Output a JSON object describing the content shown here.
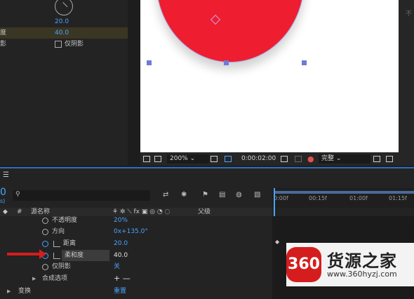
{
  "effect_controls": {
    "rows": [
      {
        "label": "",
        "value": ""
      },
      {
        "label": "",
        "value": "20.0"
      },
      {
        "label": "度",
        "value": "40.0"
      },
      {
        "label": "影",
        "checkbox_label": "仅阴影"
      }
    ]
  },
  "right_panel": {
    "label": "不"
  },
  "viewer": {
    "zoom": "200%",
    "timecode": "0:00:02:00",
    "quality": "完整",
    "colors": {
      "fill": "#ee1d2f",
      "background": "#ffffff"
    }
  },
  "timeline": {
    "comp_time": "0",
    "comp_sub": "s)",
    "columns": {
      "source_name": "源名称",
      "parent": "父级"
    },
    "ruler_ticks": [
      "0:00f",
      "00:15f",
      "01:00f",
      "01:15f"
    ],
    "rows": [
      {
        "name": "不透明度",
        "value": "20%"
      },
      {
        "name": "方向",
        "value": "0x+135.0°"
      },
      {
        "name": "距离",
        "value": "20.0"
      },
      {
        "name": "柔和度",
        "value": "40.0"
      },
      {
        "name": "仅阴影",
        "value": "关"
      },
      {
        "name": "合成选项",
        "value": "+ —"
      },
      {
        "name": "变换",
        "value": "重置"
      }
    ]
  },
  "watermark": {
    "logo": "360",
    "title": "货源之家",
    "url": "www.360hyzj.com"
  }
}
